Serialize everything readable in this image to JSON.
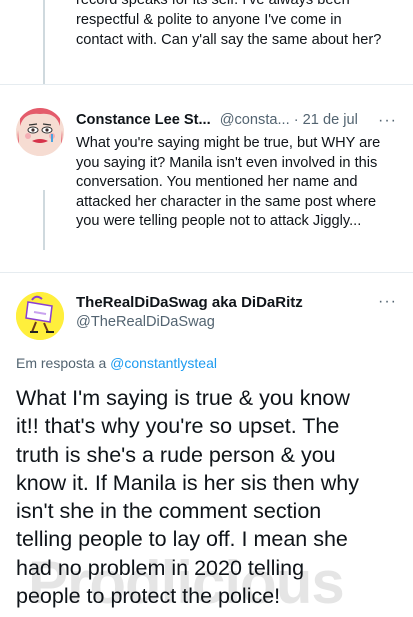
{
  "previous_tweet": {
    "lines": [
      "record speaks for its self. I've always been",
      "respectful & polite to anyone I've come in",
      "contact with. Can y'all say the same about her?"
    ]
  },
  "reply_tweet": {
    "name": "Constance Lee St...",
    "handle": "@consta...",
    "separator": "·",
    "date": "21 de jul",
    "more": "···",
    "lines": [
      "What you're saying might be true, but WHY are",
      "you saying it? Manila isn't even involved in this",
      "conversation. You mentioned her name and",
      "attacked her character in the same post where",
      "you were telling people not to attack Jiggly..."
    ]
  },
  "main_tweet": {
    "name": "TheRealDiDaSwag aka DiDaRitz",
    "handle": "@TheRealDiDaSwag",
    "more": "···",
    "replying_prefix": "Em resposta a",
    "replying_to": "@constantlysteal",
    "lines": [
      "What I'm saying is true & you know",
      "it!! that's why you're so upset. The",
      "truth is she's a rude person & you",
      "know it. If Manila is her sis then why",
      "isn't she in the comment section",
      "telling people to lay off. I mean she",
      "had no problem in 2020 telling",
      "people to protect the police!"
    ]
  },
  "watermark": "Prodlicious"
}
